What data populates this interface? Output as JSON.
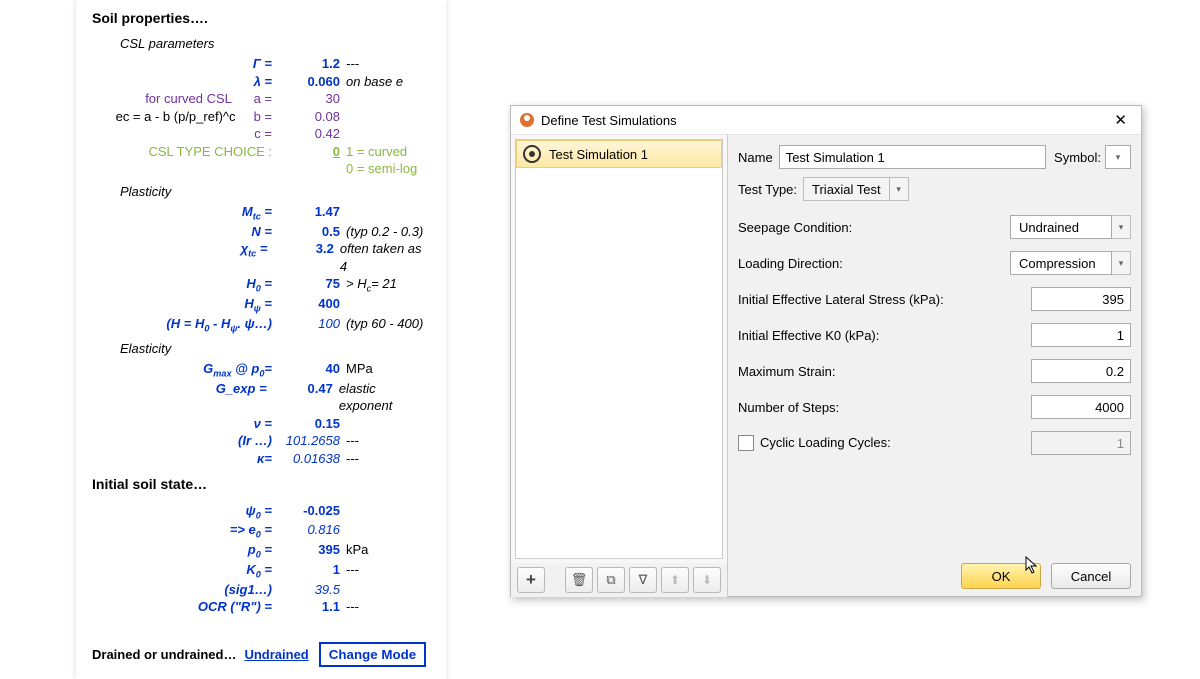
{
  "sheet": {
    "title": "Soil properties….",
    "sections": {
      "csl": "CSL parameters",
      "plasticity": "Plasticity",
      "elasticity": "Elasticity",
      "state": "Initial soil state…"
    },
    "csl": {
      "gamma_lab": "Γ =",
      "gamma_val": "1.2",
      "gamma_extra": "---",
      "lambda_lab": "λ =",
      "lambda_val": "0.060",
      "lambda_extra": "on base e",
      "curved_note": "for curved CSL",
      "a_lab": "a =",
      "a_val": "30",
      "ec_note": "ec = a - b (p/p_ref)^c",
      "b_lab": "b =",
      "b_val": "0.08",
      "c_lab": "c =",
      "c_val": "0.42",
      "type_lab": "CSL TYPE CHOICE :",
      "type_val": "0",
      "type_extra1": "1 = curved",
      "type_extra2": "0 = semi-log"
    },
    "plast": {
      "mtc_lab": "M",
      "mtc_sub": "tc",
      "mtc_eq": " =",
      "mtc_val": "1.47",
      "n_lab": "N =",
      "n_val": "0.5",
      "n_extra": "(typ 0.2 - 0.3)",
      "chi_lab": "χ",
      "chi_sub": "tc",
      "chi_eq": "  =",
      "chi_val": "3.2",
      "chi_extra": "often taken as 4",
      "h0_lab": "H",
      "h0_sub": "0",
      "h0_eq": "  =",
      "h0_val": "75",
      "h0_extra": "> H",
      "h0_extra_sub": "c",
      "h0_extra2": "= 21",
      "hy_lab": "H",
      "hy_sub": "ψ",
      "hy_eq": "  =",
      "hy_val": "400",
      "h_note": "(H = H",
      "h_note_sub1": "0",
      "h_note_mid": " - H",
      "h_note_sub2": "ψ",
      "h_note_end": ". ψ…)",
      "h_note_val": "100",
      "h_note_extra": "(typ 60 - 400)"
    },
    "elast": {
      "gmax_lab": "G",
      "gmax_sub": "max",
      "gmax_mid": " @ p",
      "gmax_sub2": "0",
      "gmax_eq": "=",
      "gmax_val": "40",
      "gmax_extra": "MPa",
      "gexp_lab": "G_exp =",
      "gexp_val": "0.47",
      "gexp_extra": "elastic  exponent",
      "nu_lab": "ν  =",
      "nu_val": "0.15",
      "ir_lab": "(Ir …)",
      "ir_val": "101.2658",
      "ir_extra": "---",
      "kappa_lab": "κ=",
      "kappa_val": "0.01638",
      "kappa_extra": "---"
    },
    "state": {
      "psi0_lab": "ψ",
      "psi0_sub": "0",
      "psi0_eq": "  =",
      "psi0_val": "-0.025",
      "e0_lab": "=> e",
      "e0_sub": "0",
      "e0_eq": "  =",
      "e0_val": "0.816",
      "p0_lab": "p",
      "p0_sub": "0",
      "p0_eq": "  =",
      "p0_val": "395",
      "p0_extra": "kPa",
      "k0_lab": "K",
      "k0_sub": "0",
      "k0_eq": "  =",
      "k0_val": "1",
      "k0_extra": "---",
      "sig1_lab": "(sig1…)",
      "sig1_val": "39.5",
      "ocr_lab": "OCR (\"R\") =",
      "ocr_val": "1.1",
      "ocr_extra": "---"
    },
    "footer": {
      "label": "Drained or undrained…",
      "link": "Undrained",
      "button": "Change Mode"
    }
  },
  "dialog": {
    "title": "Define Test Simulations",
    "list": {
      "item1": "Test Simulation 1"
    },
    "toolbar": {
      "add": "+",
      "del": "🗑",
      "copy": "⧉",
      "filter": "▽",
      "up": "↑",
      "down": "↓"
    },
    "form": {
      "name_label": "Name",
      "name_value": "Test Simulation 1",
      "symbol_label": "Symbol:",
      "testtype_label": "Test Type:",
      "testtype_value": "Triaxial Test",
      "seepage_label": "Seepage Condition:",
      "seepage_value": "Undrained",
      "loaddir_label": "Loading Direction:",
      "loaddir_value": "Compression",
      "lateral_label": "Initial Effective Lateral Stress (kPa):",
      "lateral_value": "395",
      "k0_label": "Initial Effective K0 (kPa):",
      "k0_value": "1",
      "maxstrain_label": "Maximum Strain:",
      "maxstrain_value": "0.2",
      "steps_label": "Number of Steps:",
      "steps_value": "4000",
      "cyclic_label": "Cyclic Loading Cycles:",
      "cyclic_value": "1"
    },
    "buttons": {
      "ok": "OK",
      "cancel": "Cancel"
    }
  }
}
